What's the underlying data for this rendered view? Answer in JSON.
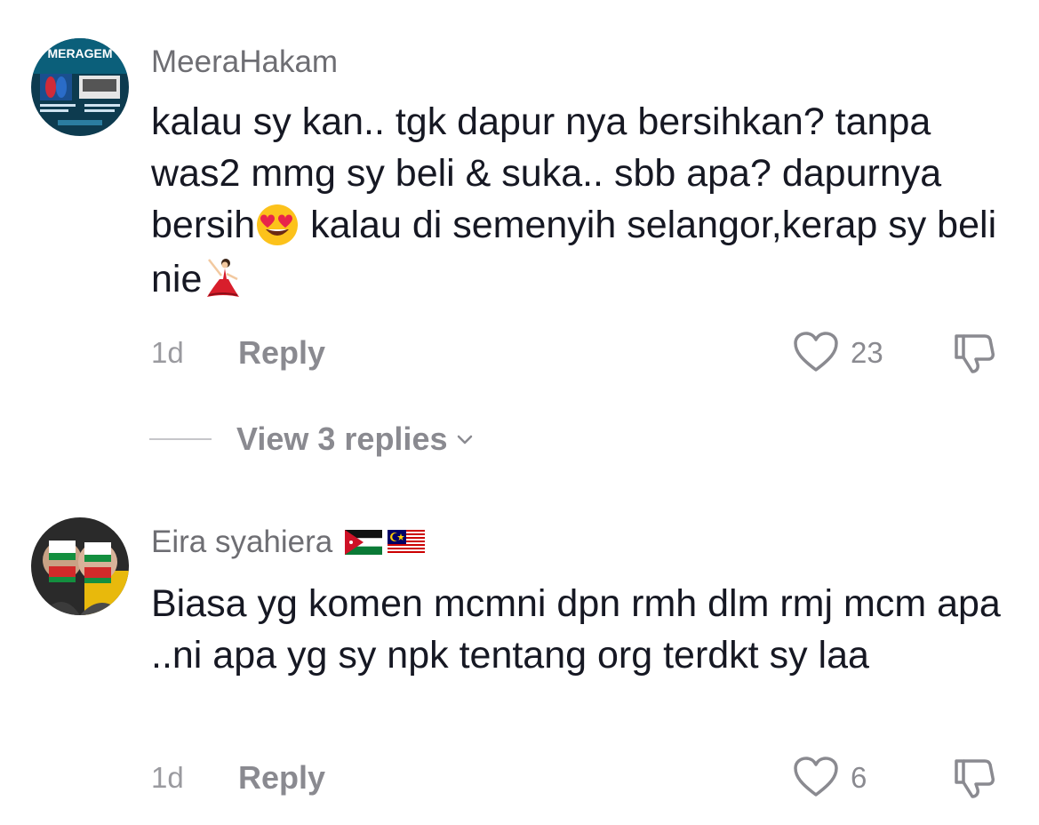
{
  "comments": [
    {
      "username": "MeeraHakam",
      "avatar_label": "MERAGEM",
      "text_parts": [
        "kalau sy kan.. tgk dapur nya bersihkan? tanpa was2 mmg sy beli & suka.. sbb apa? dapurnya bersih",
        " kalau di semenyih selangor,kerap sy beli nie"
      ],
      "emojis": [
        "heart-eyes-emoji",
        "dancer-emoji"
      ],
      "timestamp": "1d",
      "reply_label": "Reply",
      "likes": "23",
      "view_replies": "View 3 replies"
    },
    {
      "username": "Eira syahiera",
      "flags": [
        "jordan-flag",
        "malaysia-flag"
      ],
      "text": "Biasa yg komen mcmni dpn rmh dlm rmj mcm apa ..ni apa yg sy npk tentang org terdkt sy laa",
      "timestamp": "1d",
      "reply_label": "Reply",
      "likes": "6"
    }
  ],
  "colors": {
    "text": "#161823",
    "secondary": "#8a8a90",
    "username": "#6e6e73"
  }
}
